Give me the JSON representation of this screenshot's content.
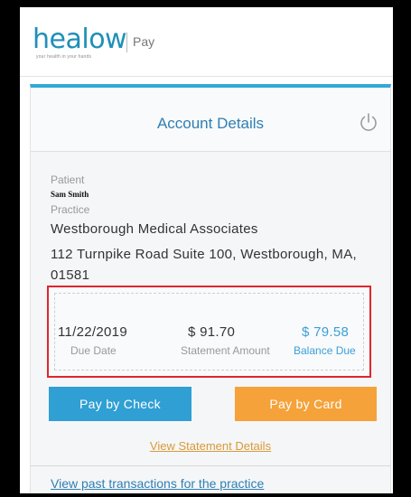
{
  "header": {
    "logo_text": "healow",
    "logo_tagline": "your health in your hands",
    "section_label": "Pay"
  },
  "card": {
    "title": "Account Details",
    "icons": {
      "logout": "power-icon"
    },
    "patient_label": "Patient",
    "patient_name": "Sam Smith",
    "practice_label": "Practice",
    "practice_name": "Westborough Medical Associates",
    "practice_address": "112 Turnpike Road Suite 100, Westborough, MA, 01581"
  },
  "summary": {
    "due_date_value": "11/22/2019",
    "due_date_label": "Due Date",
    "statement_amount_value": "$ 91.70",
    "statement_amount_label": "Statement Amount",
    "balance_due_value": "$ 79.58",
    "balance_due_label": "Balance Due"
  },
  "actions": {
    "pay_check_label": "Pay by Check",
    "pay_card_label": "Pay by Card",
    "view_statement_label": "View Statement Details",
    "past_transactions_label": "View past transactions for the practice"
  },
  "colors": {
    "brand_blue": "#2f7fb3",
    "button_blue": "#2f9fd4",
    "button_orange": "#f5a23a",
    "highlight_red": "#e0252e"
  }
}
